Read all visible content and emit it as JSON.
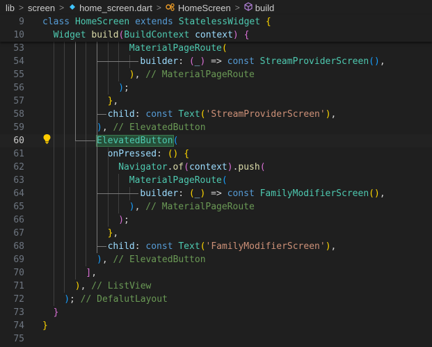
{
  "breadcrumb": {
    "items": [
      "lib",
      "screen",
      "home_screen.dart",
      "HomeScreen",
      "build"
    ],
    "separator": ">"
  },
  "sticky_lines": [
    {
      "n": "9",
      "indent": 0,
      "tokens": [
        [
          "kw",
          "class "
        ],
        [
          "cls",
          "HomeScreen "
        ],
        [
          "kw",
          "extends "
        ],
        [
          "cls",
          "StatelessWidget "
        ],
        [
          "br1",
          "{"
        ]
      ]
    },
    {
      "n": "10",
      "indent": 2,
      "tokens": [
        [
          "cls",
          "Widget "
        ],
        [
          "fn",
          "build"
        ],
        [
          "br2",
          "("
        ],
        [
          "cls",
          "BuildContext "
        ],
        [
          "var",
          "context"
        ],
        [
          "br2",
          ")"
        ],
        [
          "punc",
          " "
        ],
        [
          "br2",
          "{"
        ]
      ]
    }
  ],
  "active_line": "60",
  "lines": [
    {
      "n": "53",
      "indent": 16,
      "tokens": [
        [
          "cls",
          "MaterialPageRoute"
        ],
        [
          "br1",
          "("
        ]
      ]
    },
    {
      "n": "54",
      "indent": 18,
      "tokens": [
        [
          "lbl",
          "builder"
        ],
        [
          "punc",
          ": "
        ],
        [
          "br2",
          "("
        ],
        [
          "var",
          "_"
        ],
        [
          "br2",
          ")"
        ],
        [
          "punc",
          " => "
        ],
        [
          "kw",
          "const "
        ],
        [
          "cls",
          "StreamProviderScreen"
        ],
        [
          "br3",
          "()"
        ],
        [
          "punc",
          ","
        ]
      ]
    },
    {
      "n": "55",
      "indent": 16,
      "tokens": [
        [
          "br1",
          ")"
        ],
        [
          "punc",
          ", "
        ],
        [
          "cmt",
          "// MaterialPageRoute"
        ]
      ]
    },
    {
      "n": "56",
      "indent": 14,
      "tokens": [
        [
          "br3",
          ")"
        ],
        [
          "punc",
          ";"
        ]
      ]
    },
    {
      "n": "57",
      "indent": 12,
      "tokens": [
        [
          "br1",
          "}"
        ],
        [
          "punc",
          ","
        ]
      ]
    },
    {
      "n": "58",
      "indent": 12,
      "tokens": [
        [
          "lbl",
          "child"
        ],
        [
          "punc",
          ": "
        ],
        [
          "kw",
          "const "
        ],
        [
          "cls",
          "Text"
        ],
        [
          "br1",
          "("
        ],
        [
          "str",
          "'StreamProviderScreen'"
        ],
        [
          "br1",
          ")"
        ],
        [
          "punc",
          ","
        ]
      ]
    },
    {
      "n": "59",
      "indent": 10,
      "tokens": [
        [
          "br3",
          ")"
        ],
        [
          "punc",
          ", "
        ],
        [
          "cmt",
          "// ElevatedButton"
        ]
      ]
    },
    {
      "n": "60",
      "indent": 10,
      "tokens": [
        [
          "cls hl",
          "ElevatedButton"
        ],
        [
          "br3",
          "("
        ]
      ]
    },
    {
      "n": "61",
      "indent": 12,
      "tokens": [
        [
          "lbl",
          "onPressed"
        ],
        [
          "punc",
          ": "
        ],
        [
          "br1",
          "()"
        ],
        [
          "punc",
          " "
        ],
        [
          "br1",
          "{"
        ]
      ]
    },
    {
      "n": "62",
      "indent": 14,
      "tokens": [
        [
          "cls",
          "Navigator"
        ],
        [
          "punc",
          "."
        ],
        [
          "fn",
          "of"
        ],
        [
          "br2",
          "("
        ],
        [
          "var",
          "context"
        ],
        [
          "br2",
          ")"
        ],
        [
          "punc",
          "."
        ],
        [
          "fn",
          "push"
        ],
        [
          "br2",
          "("
        ]
      ]
    },
    {
      "n": "63",
      "indent": 16,
      "tokens": [
        [
          "cls",
          "MaterialPageRoute"
        ],
        [
          "br3",
          "("
        ]
      ]
    },
    {
      "n": "64",
      "indent": 18,
      "tokens": [
        [
          "lbl",
          "builder"
        ],
        [
          "punc",
          ": "
        ],
        [
          "br1",
          "("
        ],
        [
          "var",
          "_"
        ],
        [
          "br1",
          ")"
        ],
        [
          "punc",
          " => "
        ],
        [
          "kw",
          "const "
        ],
        [
          "cls",
          "FamilyModifierScreen"
        ],
        [
          "br1",
          "()"
        ],
        [
          "punc",
          ","
        ]
      ]
    },
    {
      "n": "65",
      "indent": 16,
      "tokens": [
        [
          "br3",
          ")"
        ],
        [
          "punc",
          ", "
        ],
        [
          "cmt",
          "// MaterialPageRoute"
        ]
      ]
    },
    {
      "n": "66",
      "indent": 14,
      "tokens": [
        [
          "br2",
          ")"
        ],
        [
          "punc",
          ";"
        ]
      ]
    },
    {
      "n": "67",
      "indent": 12,
      "tokens": [
        [
          "br1",
          "}"
        ],
        [
          "punc",
          ","
        ]
      ]
    },
    {
      "n": "68",
      "indent": 12,
      "tokens": [
        [
          "lbl",
          "child"
        ],
        [
          "punc",
          ": "
        ],
        [
          "kw",
          "const "
        ],
        [
          "cls",
          "Text"
        ],
        [
          "br1",
          "("
        ],
        [
          "str",
          "'FamilyModifierScreen'"
        ],
        [
          "br1",
          ")"
        ],
        [
          "punc",
          ","
        ]
      ]
    },
    {
      "n": "69",
      "indent": 10,
      "tokens": [
        [
          "br3",
          ")"
        ],
        [
          "punc",
          ", "
        ],
        [
          "cmt",
          "// ElevatedButton"
        ]
      ]
    },
    {
      "n": "70",
      "indent": 8,
      "tokens": [
        [
          "br2",
          "]"
        ],
        [
          "punc",
          ","
        ]
      ]
    },
    {
      "n": "71",
      "indent": 6,
      "tokens": [
        [
          "br1",
          ")"
        ],
        [
          "punc",
          ", "
        ],
        [
          "cmt",
          "// ListView"
        ]
      ]
    },
    {
      "n": "72",
      "indent": 4,
      "tokens": [
        [
          "br3",
          ")"
        ],
        [
          "punc",
          "; "
        ],
        [
          "cmt",
          "// DefalutLayout"
        ]
      ]
    },
    {
      "n": "73",
      "indent": 2,
      "tokens": [
        [
          "br2",
          "}"
        ]
      ]
    },
    {
      "n": "74",
      "indent": 0,
      "tokens": [
        [
          "br1",
          "}"
        ]
      ]
    },
    {
      "n": "75",
      "indent": 0,
      "tokens": []
    }
  ],
  "icons": {
    "class-icon": "HomeScreen",
    "method-icon": "build",
    "lightbulb-icon": "code actions"
  },
  "colors": {
    "background": "#1f1f1f",
    "keyword": "#569cd6",
    "class": "#4ec9b0",
    "function": "#dcdcaa",
    "string": "#ce9178",
    "comment": "#6a9955"
  }
}
